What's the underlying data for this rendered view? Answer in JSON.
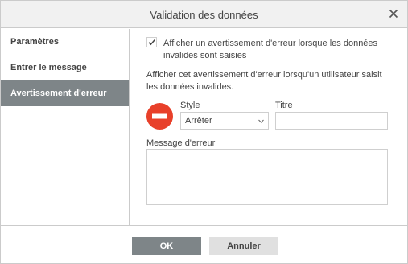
{
  "dialog": {
    "title": "Validation des données",
    "close_icon": "close-icon"
  },
  "sidebar": {
    "items": [
      {
        "label": "Paramètres",
        "active": false
      },
      {
        "label": "Entrer le message",
        "active": false
      },
      {
        "label": "Avertissement d'erreur",
        "active": true
      }
    ]
  },
  "error_alert": {
    "show_checkbox_checked": true,
    "show_checkbox_label": "Afficher un avertissement d'erreur lorsque les données invalides sont saisies",
    "info_text": "Afficher cet avertissement d'erreur lorsqu'un utilisateur saisit les données invalides.",
    "style_icon": "stop-icon",
    "style_label": "Style",
    "style_value": "Arrêter",
    "title_label": "Titre",
    "title_value": "",
    "message_label": "Message d'erreur",
    "message_value": ""
  },
  "footer": {
    "ok_label": "OK",
    "cancel_label": "Annuler"
  },
  "colors": {
    "accent": "#7e8588",
    "stop_red": "#e8402a",
    "border": "#cbcbcb"
  }
}
